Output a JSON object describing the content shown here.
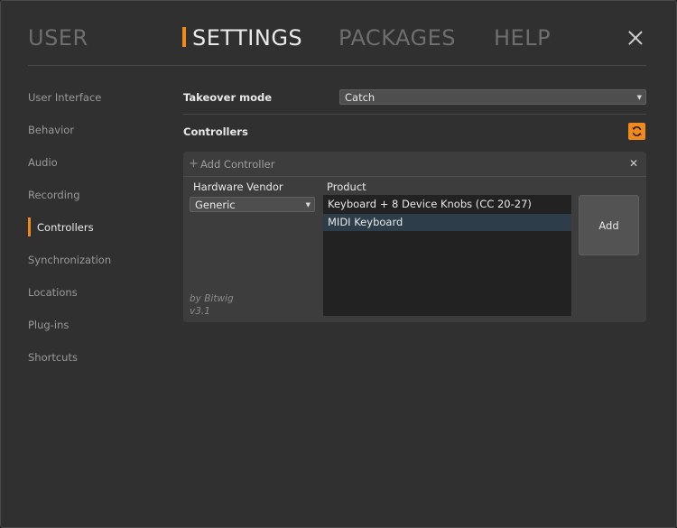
{
  "nav": {
    "tabs": [
      {
        "label": "USER"
      },
      {
        "label": "SETTINGS"
      },
      {
        "label": "PACKAGES"
      },
      {
        "label": "HELP"
      }
    ],
    "active_tab": "SETTINGS"
  },
  "sidebar": {
    "items": [
      {
        "label": "User Interface"
      },
      {
        "label": "Behavior"
      },
      {
        "label": "Audio"
      },
      {
        "label": "Recording"
      },
      {
        "label": "Controllers"
      },
      {
        "label": "Synchronization"
      },
      {
        "label": "Locations"
      },
      {
        "label": "Plug-ins"
      },
      {
        "label": "Shortcuts"
      }
    ],
    "active_item": "Controllers"
  },
  "settings": {
    "takeover_label": "Takeover mode",
    "takeover_value": "Catch",
    "controllers_label": "Controllers"
  },
  "add_controller": {
    "title": "Add Controller",
    "vendor_label": "Hardware Vendor",
    "vendor_value": "Generic",
    "product_label": "Product",
    "products": [
      {
        "label": "Keyboard + 8 Device Knobs (CC 20-27)"
      },
      {
        "label": "MIDI Keyboard"
      }
    ],
    "selected_product": "MIDI Keyboard",
    "byline_author": "by Bitwig",
    "byline_version": "v3.1",
    "add_label": "Add"
  },
  "icons": {
    "close": "close-icon",
    "refresh": "refresh-icon",
    "plus": "plus-icon",
    "dropdown": "chevron-down-icon"
  },
  "colors": {
    "accent": "#f08a1c",
    "background": "#303030",
    "panel": "#3d3d3d",
    "list_background": "#222222",
    "selection": "#2d3e4a"
  }
}
